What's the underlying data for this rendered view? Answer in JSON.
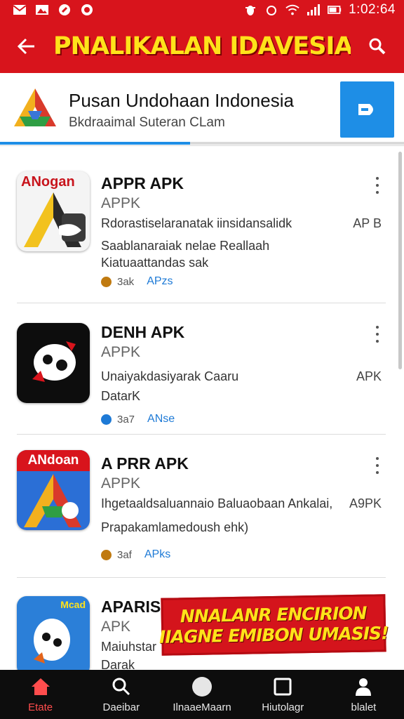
{
  "status_bar": {
    "time": "1:02:64",
    "left_icons": [
      "mail-icon",
      "photo-icon",
      "app-icon",
      "app-icon"
    ],
    "right_icons": [
      "bug-icon",
      "alarm-icon",
      "wifi-icon",
      "signal-icon",
      "battery-icon"
    ]
  },
  "app_bar": {
    "title": "PNALIKALAN IDAVESIA",
    "back_icon": "back-arrow-icon",
    "search_icon": "search-icon",
    "color": "#d8141c",
    "title_color": "#ffe21a"
  },
  "banner": {
    "title": "Pusan Undohaan Indonesia",
    "subtitle": "Bkdraaimal Suteran CLam",
    "button_icon": "send-icon",
    "button_color": "#1e8ee6",
    "progress": 0.47
  },
  "apps": [
    {
      "icon_label": "ANogan",
      "name": "APPR APK",
      "kind": "APPK",
      "description_lines": [
        "Rdorastiselaranatak iinsidansalidk",
        "Saablanaraiak nelae Reallaah",
        "Kiatuaattandas sak"
      ],
      "tag": "AP B",
      "meta_count": "3ak",
      "meta_tag": "APzs",
      "meta_color": "#c07a10"
    },
    {
      "icon_label": "",
      "name": "DENH APK",
      "kind": "APPK",
      "description_lines": [
        "Unaiyakdasiyarak Caaru",
        "DatarK"
      ],
      "tag": "APK",
      "meta_count": "3a7",
      "meta_tag": "ANse",
      "meta_color": "#1e7ad6"
    },
    {
      "icon_label": "ANdoan",
      "name": "A PRR APK",
      "kind": "APPK",
      "description_lines": [
        "Ihgetaaldsaluannaio Baluaobaan Ankalai,",
        "Prapakamlamedoush ehk)"
      ],
      "tag": "A9PK",
      "meta_count": "3af",
      "meta_tag": "APks",
      "meta_color": "#c07a10"
    },
    {
      "icon_label": "Mcad",
      "name": "APARISA",
      "kind": "APK",
      "description_lines": [
        "Maiuhstar",
        "Darak"
      ],
      "tag": "",
      "meta_count": "",
      "meta_tag": "",
      "meta_color": "#c07a10"
    }
  ],
  "promo": {
    "line1": "NNALANR ENCIRION",
    "line2": "IIAGNE EMIBON UMASIS!"
  },
  "bottom_nav": [
    {
      "label": "Etate",
      "icon": "home-icon",
      "active": true
    },
    {
      "label": "Daeibar",
      "icon": "search-icon",
      "active": false
    },
    {
      "label": "IlnaaeMaarn",
      "icon": "circle-icon",
      "active": false
    },
    {
      "label": "Hiutolagr",
      "icon": "square-icon",
      "active": false
    },
    {
      "label": "blalet",
      "icon": "person-icon",
      "active": false
    }
  ]
}
